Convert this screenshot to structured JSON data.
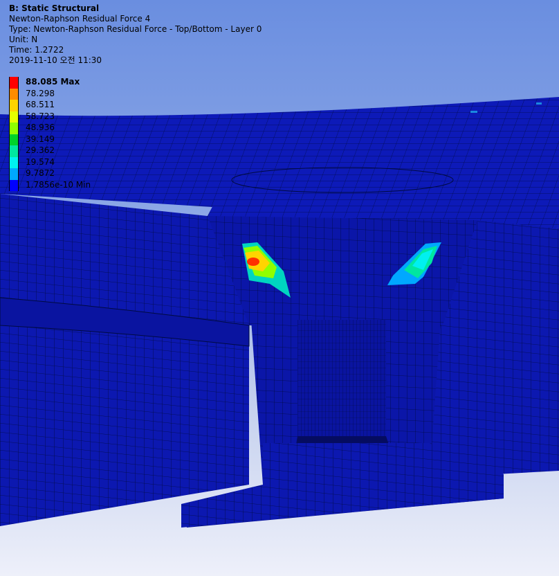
{
  "info": {
    "title": "B: Static Structural",
    "result": "Newton-Raphson Residual Force 4",
    "type": "Type: Newton-Raphson Residual Force - Top/Bottom - Layer 0",
    "unit": "Unit: N",
    "time": "Time: 1.2722",
    "date": "2019-11-10 오전 11:30"
  },
  "legend": {
    "entries": [
      {
        "label": "88.085 Max",
        "color": "#ff0000"
      },
      {
        "label": "78.298",
        "color": "#ff8c00"
      },
      {
        "label": "68.511",
        "color": "#ffd400"
      },
      {
        "label": "58.723",
        "color": "#e6ff00"
      },
      {
        "label": "48.936",
        "color": "#90ff00"
      },
      {
        "label": "39.149",
        "color": "#00d22a"
      },
      {
        "label": "29.362",
        "color": "#00e6a0"
      },
      {
        "label": "19.574",
        "color": "#00f0f0"
      },
      {
        "label": "9.7872",
        "color": "#00a8ff"
      },
      {
        "label": "1.7856e-10 Min",
        "color": "#0000ff"
      }
    ]
  },
  "colors": {
    "mesh_fill": "#0c18b0",
    "mesh_dark": "#07106e",
    "mesh_line": "#000832",
    "background_top": "#6a8ee0",
    "background_bottom": "#eef0fa"
  }
}
